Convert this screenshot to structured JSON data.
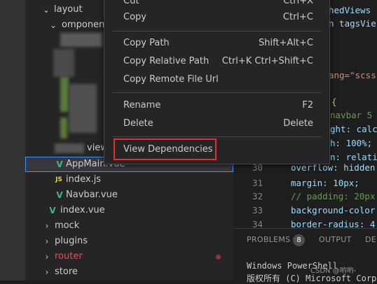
{
  "explorer": {
    "items": [
      {
        "label": "layout",
        "kind": "folder-open"
      },
      {
        "label": "omponent",
        "kind": "folder-open"
      },
      {
        "label": "AppMain.vue",
        "kind": "vue",
        "selected": true
      },
      {
        "label": "index.js",
        "kind": "js",
        "icon_text": "JS"
      },
      {
        "label": "Navbar.vue",
        "kind": "vue"
      },
      {
        "label": "index.vue",
        "kind": "vue"
      },
      {
        "label": "mock",
        "kind": "folder"
      },
      {
        "label": "plugins",
        "kind": "folder"
      },
      {
        "label": "router",
        "kind": "folder",
        "modified": true
      },
      {
        "label": "store",
        "kind": "folder"
      }
    ],
    "partial_labels": [
      "view",
      "w"
    ]
  },
  "editor": {
    "top_fragments": [
      "hedViews",
      "n tagsVie"
    ],
    "mid_fragment": "ang=\"scss\"",
    "lines": [
      {
        "num": "",
        "text": "{"
      },
      {
        "num": "",
        "text": "navbar  5"
      },
      {
        "num": "",
        "text": "ght: calc"
      },
      {
        "num": "",
        "text": "h: 100%;"
      },
      {
        "num": "",
        "text": "n: relati"
      },
      {
        "num": "30",
        "text": "overflow: hidden"
      },
      {
        "num": "31",
        "text": "margin: 10px;"
      },
      {
        "num": "32",
        "text": "// padding: 20px"
      },
      {
        "num": "33",
        "text": "background-color"
      },
      {
        "num": "34",
        "text": "border-radius: 4"
      }
    ]
  },
  "panel": {
    "tabs": [
      "PROBLEMS",
      "OUTPUT",
      "DEB"
    ],
    "problems_count": "8",
    "terminal_lines": [
      "Windows PowerShell",
      "版权所有 (C) Microsoft Corp"
    ],
    "watermark": "CSDN @哟哟-"
  },
  "context_menu": {
    "items": [
      {
        "label": "Cut",
        "shortcut": "Ctrl+X"
      },
      {
        "label": "Copy",
        "shortcut": "Ctrl+C"
      },
      {
        "label": "Copy Path",
        "shortcut": "Shift+Alt+C"
      },
      {
        "label": "Copy Relative Path",
        "shortcut": "Ctrl+K Ctrl+Shift+C"
      },
      {
        "label": "Copy Remote File Url",
        "shortcut": ""
      },
      {
        "label": "Rename",
        "shortcut": "F2"
      },
      {
        "label": "Delete",
        "shortcut": "Delete"
      },
      {
        "label": "View Dependencies",
        "shortcut": ""
      }
    ]
  },
  "colors": {
    "highlight_box": "#e03030",
    "vue": "#41b883",
    "selection_border": "#3794ff"
  }
}
